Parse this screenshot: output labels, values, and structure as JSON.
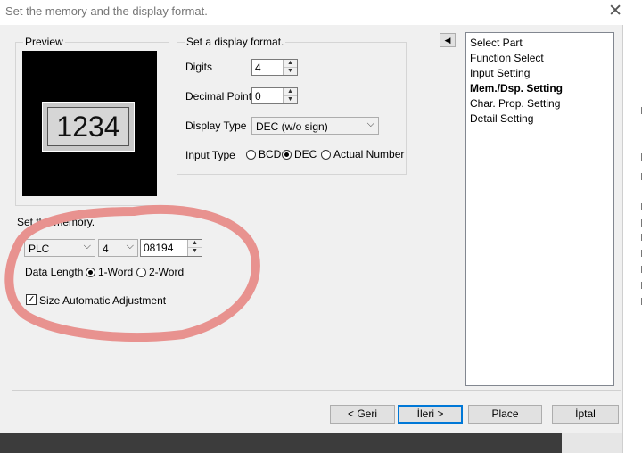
{
  "window": {
    "title": "Set the memory and the display format.",
    "close_glyph": "✕"
  },
  "preview": {
    "title": "Preview",
    "value": "1234"
  },
  "display_format": {
    "title": "Set a display format.",
    "digits_label": "Digits",
    "digits_value": "4",
    "decimal_point_label": "Decimal Point",
    "decimal_point_value": "0",
    "display_type_label": "Display Type",
    "display_type_value": "DEC (w/o sign)",
    "input_type_label": "Input Type",
    "input_type_options": [
      "BCD",
      "DEC",
      "Actual Number"
    ],
    "input_type_selected": "DEC"
  },
  "memory": {
    "title": "Set the memory.",
    "device": "PLC",
    "station": "4",
    "address": "08194",
    "data_length_label": "Data Length",
    "data_length_options": [
      "1-Word",
      "2-Word"
    ],
    "data_length_selected": "1-Word",
    "size_auto_label": "Size Automatic Adjustment",
    "size_auto_checked": true
  },
  "nav": {
    "collapse_glyph": "◀",
    "items": [
      "Select Part",
      "Function Select",
      "Input Setting",
      "Mem./Dsp. Setting",
      "Char. Prop. Setting",
      "Detail Setting"
    ],
    "current": "Mem./Dsp. Setting"
  },
  "buttons": {
    "back": "< Geri",
    "next": "İleri >",
    "place": "Place",
    "cancel": "İptal"
  },
  "annotation_color": "#e8928f"
}
